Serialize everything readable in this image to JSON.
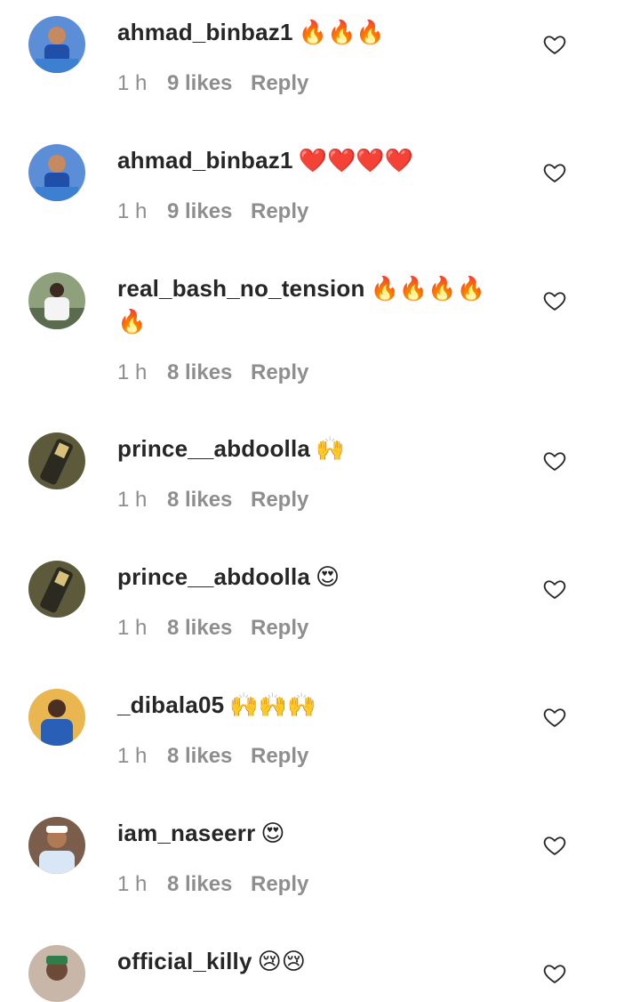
{
  "comments": [
    {
      "username": "ahmad_binbaz1",
      "text": "🔥🔥🔥",
      "time": "1 h",
      "likes": "9 likes",
      "reply": "Reply",
      "avatar_bg": "#4a7fc8"
    },
    {
      "username": "ahmad_binbaz1",
      "text": "❤️❤️❤️❤️",
      "time": "1 h",
      "likes": "9 likes",
      "reply": "Reply",
      "avatar_bg": "#4a7fc8"
    },
    {
      "username": "real_bash_no_tension",
      "text": "🔥🔥🔥🔥 🔥",
      "time": "1 h",
      "likes": "8 likes",
      "reply": "Reply",
      "avatar_bg": "#5b6b4e"
    },
    {
      "username": "prince__abdoolla",
      "text": "🙌",
      "time": "1 h",
      "likes": "8 likes",
      "reply": "Reply",
      "avatar_bg": "#5d5a3c"
    },
    {
      "username": "prince__abdoolla",
      "text": "😍",
      "time": "1 h",
      "likes": "8 likes",
      "reply": "Reply",
      "avatar_bg": "#5d5a3c"
    },
    {
      "username": "_dibala05",
      "text": "🙌🙌🙌",
      "time": "1 h",
      "likes": "8 likes",
      "reply": "Reply",
      "avatar_bg": "#e7b04a"
    },
    {
      "username": "iam_naseerr",
      "text": "😍",
      "time": "1 h",
      "likes": "8 likes",
      "reply": "Reply",
      "avatar_bg": "#8a6a55"
    },
    {
      "username": "official_killy",
      "text": "😢😢",
      "time": "",
      "likes": "",
      "reply": "",
      "avatar_bg": "#b8a394"
    }
  ],
  "icons": {
    "like": "heart-outline-icon"
  },
  "colors": {
    "username": "#262626",
    "meta": "#8e8e8e",
    "heart_stroke": "#262626"
  }
}
